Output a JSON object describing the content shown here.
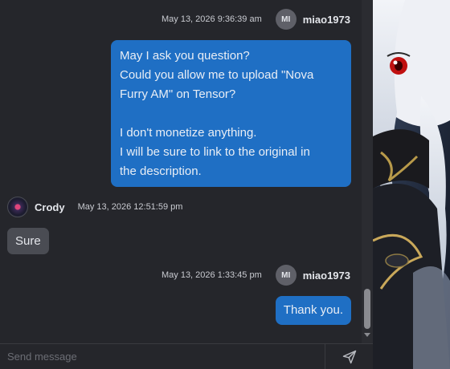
{
  "messages": [
    {
      "timestamp": "May 13, 2026 9:36:39 am",
      "avatar_initials": "MI",
      "username": "miao1973",
      "lines": [
        "May I ask you question?",
        "Could you allow me to upload \"Nova",
        "Furry AM\" on Tensor?",
        "",
        "I don't monetize anything.",
        "I will be sure to link to the original in",
        "the description."
      ]
    },
    {
      "username": "Crody",
      "timestamp": "May 13, 2026 12:51:59 pm",
      "text": "Sure"
    },
    {
      "timestamp": "May 13, 2026 1:33:45 pm",
      "avatar_initials": "MI",
      "username": "miao1973",
      "text": "Thank you."
    }
  ],
  "composer": {
    "placeholder": "Send message",
    "send_icon": "paper-plane-icon"
  },
  "colors": {
    "outgoing_bubble": "#1f6fc4",
    "incoming_bubble": "#4a4c53",
    "background": "#25262b"
  }
}
